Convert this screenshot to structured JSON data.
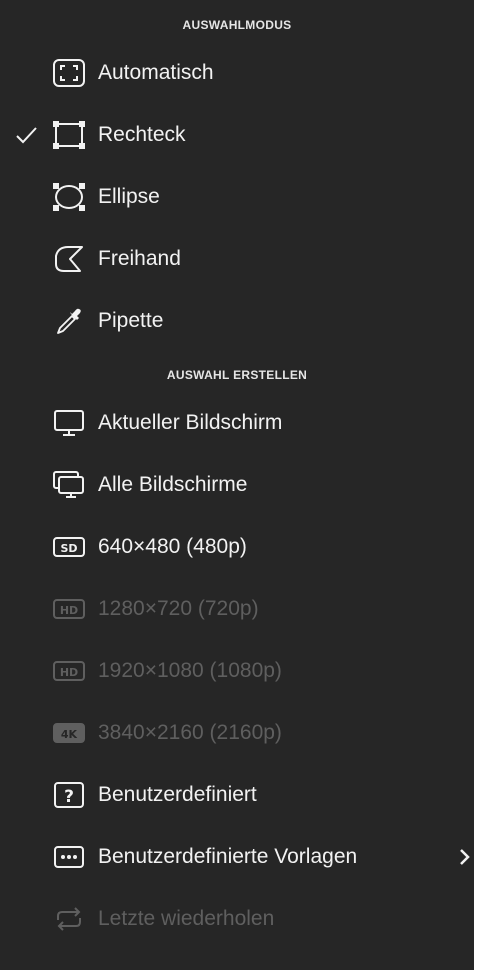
{
  "sections": {
    "mode_header": "AUSWAHLMODUS",
    "create_header": "AUSWAHL ERSTELLEN"
  },
  "mode_items": [
    {
      "label": "Automatisch",
      "icon": "auto-frame-icon",
      "checked": false
    },
    {
      "label": "Rechteck",
      "icon": "rectangle-icon",
      "checked": true
    },
    {
      "label": "Ellipse",
      "icon": "ellipse-icon",
      "checked": false
    },
    {
      "label": "Freihand",
      "icon": "freehand-icon",
      "checked": false
    },
    {
      "label": "Pipette",
      "icon": "eyedropper-icon",
      "checked": false
    }
  ],
  "create_items": [
    {
      "label": "Aktueller Bildschirm",
      "icon": "monitor-icon",
      "enabled": true
    },
    {
      "label": "Alle Bildschirme",
      "icon": "monitors-icon",
      "enabled": true
    },
    {
      "label": "640×480 (480p)",
      "icon": "sd-badge-icon",
      "badge": "SD",
      "enabled": true
    },
    {
      "label": "1280×720 (720p)",
      "icon": "hd-badge-icon",
      "badge": "HD",
      "enabled": false
    },
    {
      "label": "1920×1080 (1080p)",
      "icon": "hd-badge-icon",
      "badge": "HD",
      "enabled": false
    },
    {
      "label": "3840×2160 (2160p)",
      "icon": "4k-badge-icon",
      "badge": "4K",
      "enabled": false
    },
    {
      "label": "Benutzerdefiniert",
      "icon": "question-box-icon",
      "badge": "?",
      "enabled": true
    },
    {
      "label": "Benutzerdefinierte Vorlagen",
      "icon": "ellipsis-box-icon",
      "enabled": true,
      "submenu": true
    },
    {
      "label": "Letzte wiederholen",
      "icon": "repeat-icon",
      "enabled": false
    }
  ],
  "colors": {
    "background": "#262626",
    "text": "#f2f2f2",
    "disabled_text": "#5f5f5f"
  }
}
